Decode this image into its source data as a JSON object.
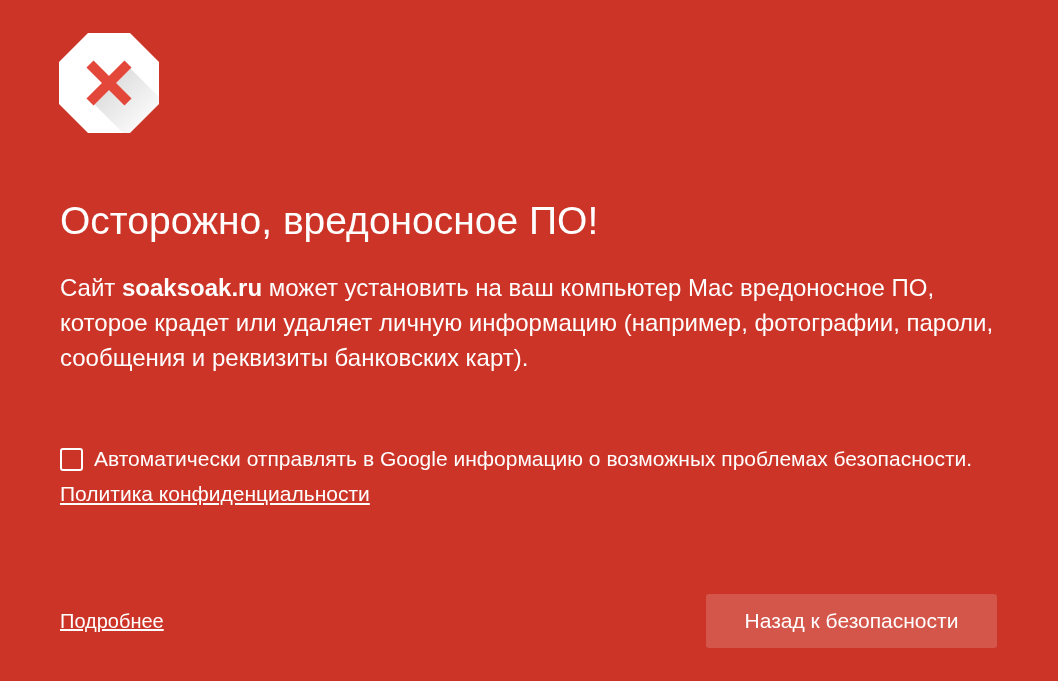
{
  "heading": "Осторожно, вредоносное ПО!",
  "message": "Сайт **soaksoak.ru** может установить на ваш компьютер Mac вредоносное ПО, которое крадет или удаляет личную информацию (например, фотографии, пароли, сообщения и реквизиты банковских карт).",
  "report_option": {
    "label": "Автоматически отправлять в Google информацию о возможных проблемах безопасности.",
    "checked": false
  },
  "privacy_link": "Политика конфиденциальности",
  "footer": {
    "details_link": "Подробнее",
    "back_button": "Назад к безопасности"
  }
}
